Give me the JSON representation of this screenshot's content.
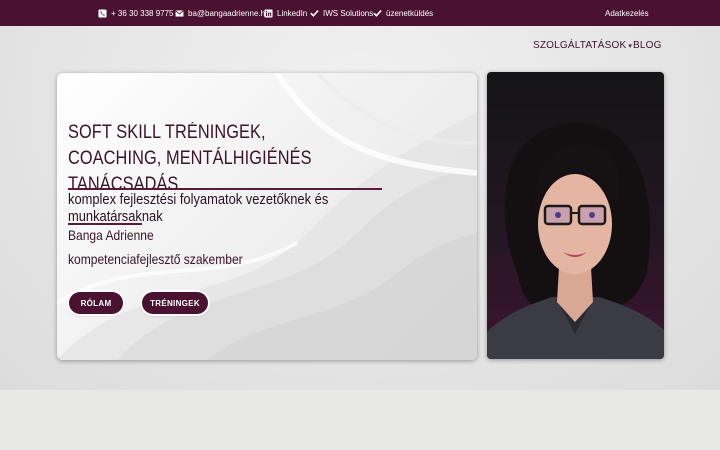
{
  "topbar": {
    "phone": "+ 36 30 338 9775",
    "email": "ba@bangaadrienne.hu",
    "linkedin": "LinkedIn",
    "iws": "IWS Solutions",
    "message": "üzenetküldés",
    "privacy": "Adatkezelés"
  },
  "nav": {
    "services": "SZOLGÁLTATÁSOK",
    "blog": "BLOG"
  },
  "hero": {
    "title_line1": "SOFT SKILL TRÉNINGEK,",
    "title_line2": "COACHING, MENTÁLHIGIÉNÉS TANÁCSADÁS",
    "subtitle": "komplex fejlesztési folyamatok vezetőknek és munkatársaknak",
    "name": "Banga Adrienne",
    "role": "kompetenciafejlesztő szakember",
    "btn_about": "RÓLAM",
    "btn_trainings": "TRÉNINGEK"
  },
  "colors": {
    "brand": "#4a1130",
    "text": "#3a1428"
  },
  "icons": [
    "phone-icon",
    "envelope-icon",
    "linkedin-icon",
    "check-icon",
    "check-icon",
    "chevron-down-icon"
  ]
}
